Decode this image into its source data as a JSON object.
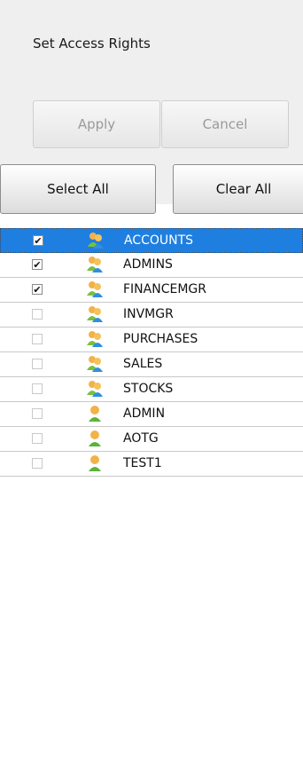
{
  "title": "Set Access Rights",
  "buttons": {
    "apply": "Apply",
    "cancel": "Cancel",
    "select_all": "Select All",
    "clear_all": "Clear All"
  },
  "colors": {
    "selection": "#1f7fe0",
    "header_bg": "#efefef"
  },
  "check_mark": "✔",
  "rows": [
    {
      "name": "ACCOUNTS",
      "checked": true,
      "type": "group",
      "selected": true
    },
    {
      "name": "ADMINS",
      "checked": true,
      "type": "group",
      "selected": false
    },
    {
      "name": "FINANCEMGR",
      "checked": true,
      "type": "group",
      "selected": false
    },
    {
      "name": "INVMGR",
      "checked": false,
      "type": "group",
      "selected": false
    },
    {
      "name": "PURCHASES",
      "checked": false,
      "type": "group",
      "selected": false
    },
    {
      "name": "SALES",
      "checked": false,
      "type": "group",
      "selected": false
    },
    {
      "name": "STOCKS",
      "checked": false,
      "type": "group",
      "selected": false
    },
    {
      "name": "ADMIN",
      "checked": false,
      "type": "user",
      "selected": false
    },
    {
      "name": "AOTG",
      "checked": false,
      "type": "user",
      "selected": false
    },
    {
      "name": "TEST1",
      "checked": false,
      "type": "user",
      "selected": false
    }
  ]
}
